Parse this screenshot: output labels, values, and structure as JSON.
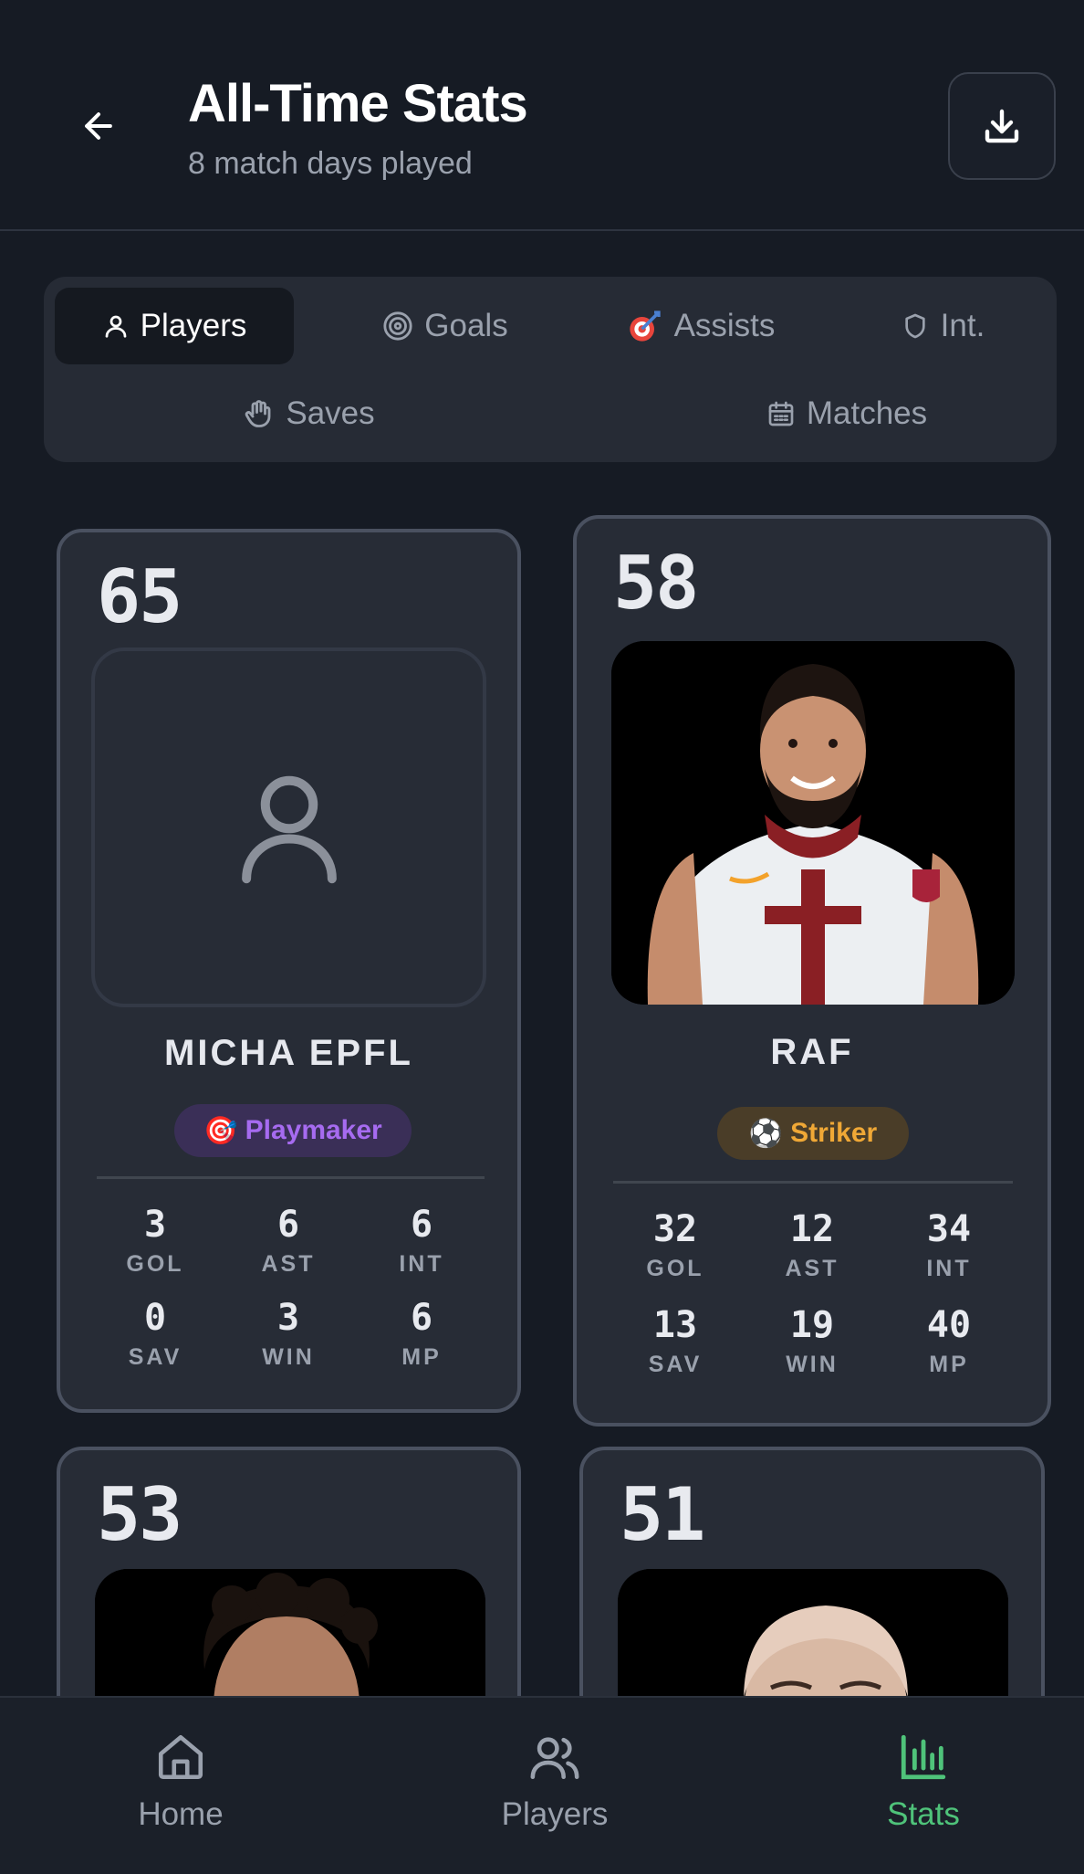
{
  "header": {
    "title": "All-Time Stats",
    "subtitle": "8 match days played",
    "back_icon": "arrow-left-icon",
    "download_icon": "download-icon"
  },
  "tabs": [
    {
      "label": "Players",
      "icon": "user-icon",
      "active": true
    },
    {
      "label": "Goals",
      "icon": "target-icon",
      "active": false
    },
    {
      "label": "Assists",
      "icon": "dart-icon",
      "active": false
    },
    {
      "label": "Int.",
      "icon": "shield-icon",
      "active": false
    },
    {
      "label": "Saves",
      "icon": "hand-icon",
      "active": false
    },
    {
      "label": "Matches",
      "icon": "calendar-icon",
      "active": false
    }
  ],
  "players": [
    {
      "rating": "65",
      "name": "MICHA EPFL",
      "badge": "Playmaker",
      "badge_emoji": "🎯",
      "has_photo": false,
      "stats": {
        "gol": "3",
        "ast": "6",
        "int": "6",
        "sav": "0",
        "win": "3",
        "mp": "6"
      }
    },
    {
      "rating": "58",
      "name": "RAF",
      "badge": "Striker",
      "badge_emoji": "⚽",
      "has_photo": true,
      "stats": {
        "gol": "32",
        "ast": "12",
        "int": "34",
        "sav": "13",
        "win": "19",
        "mp": "40"
      }
    },
    {
      "rating": "53",
      "has_photo": true
    },
    {
      "rating": "51",
      "has_photo": true
    }
  ],
  "stat_labels": {
    "gol": "GOL",
    "ast": "AST",
    "int": "INT",
    "sav": "SAV",
    "win": "WIN",
    "mp": "MP"
  },
  "nav": [
    {
      "label": "Home",
      "icon": "home-icon",
      "active": false
    },
    {
      "label": "Players",
      "icon": "users-icon",
      "active": false
    },
    {
      "label": "Stats",
      "icon": "bar-chart-icon",
      "active": true
    }
  ],
  "colors": {
    "accent": "#4fc37a",
    "playmaker": "#a66bf0",
    "striker": "#f0a836",
    "background": "#161b24",
    "card": "#272c36"
  }
}
